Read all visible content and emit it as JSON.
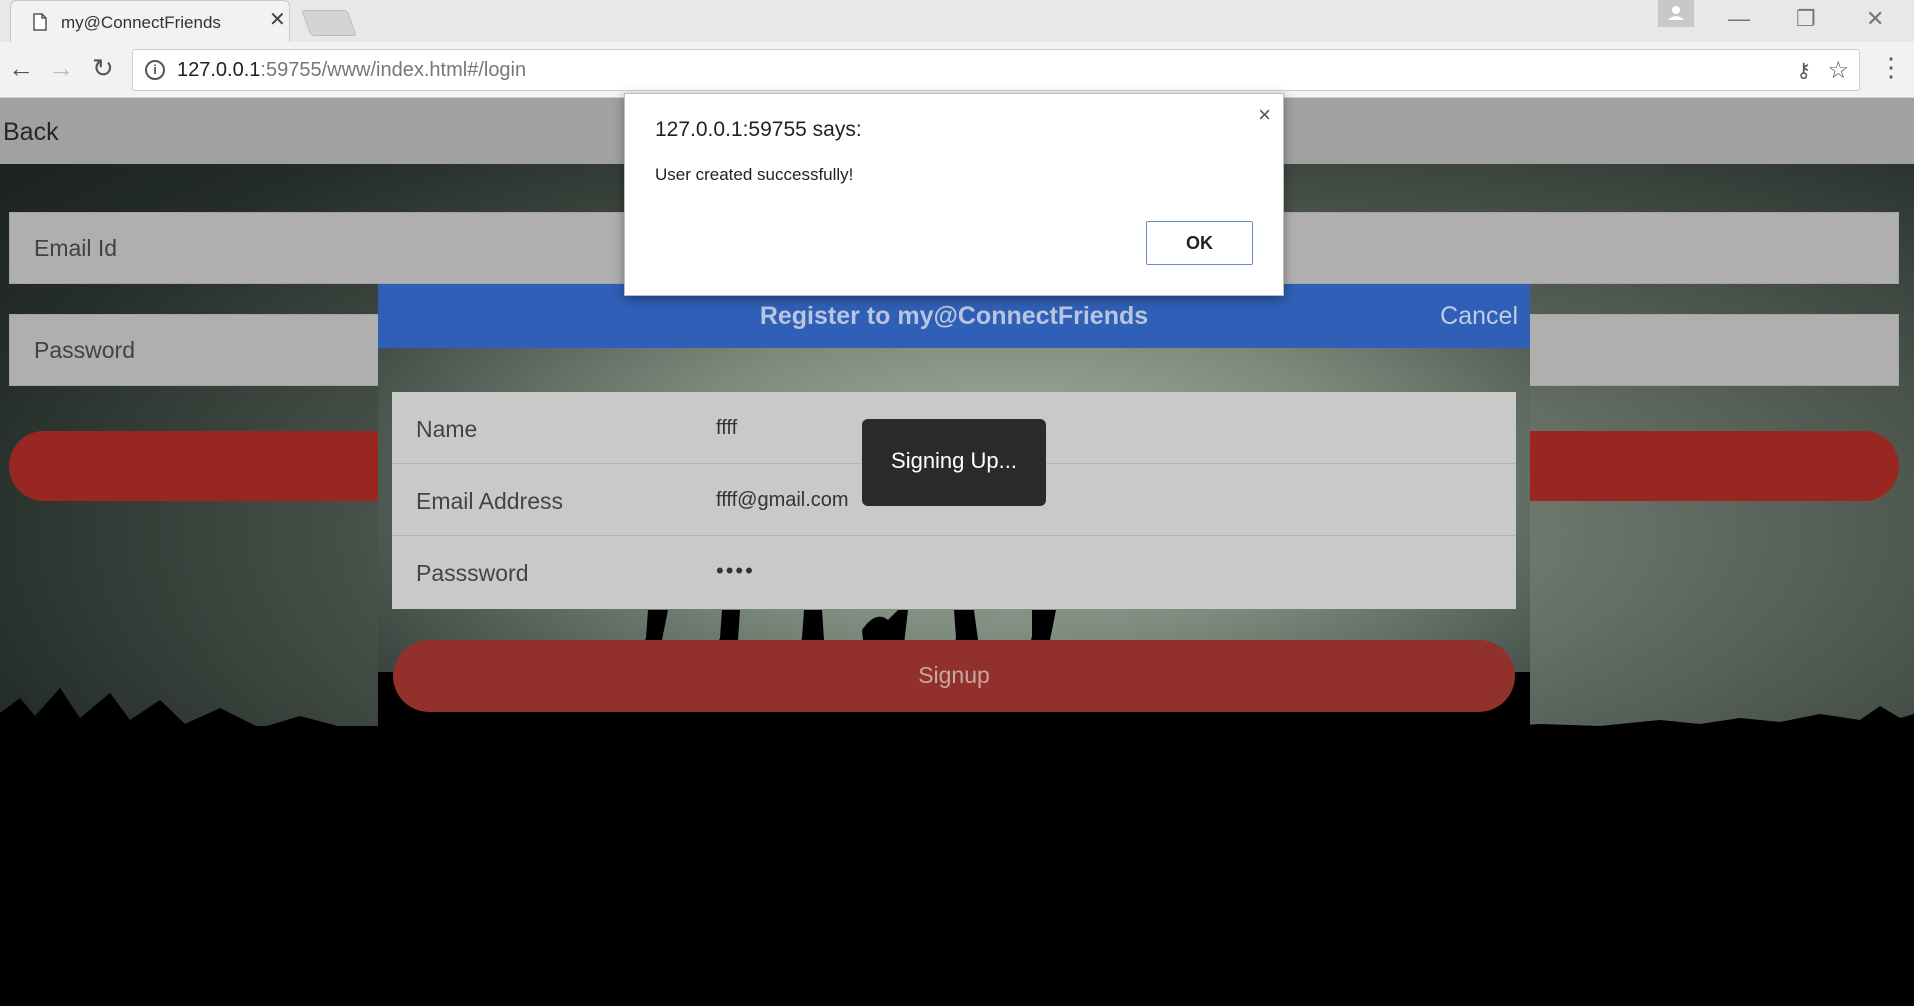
{
  "browser": {
    "tab_title": "my@ConnectFriends",
    "tab_close": "✕",
    "url_host": "127.0.0.1",
    "url_rest": ":59755/www/index.html#/login",
    "icons": [
      "page-icon",
      "back-arrow-icon",
      "forward-arrow-icon",
      "reload-icon",
      "info-icon",
      "key-icon",
      "star-icon",
      "menu-icon",
      "profile-icon",
      "minimize-icon",
      "restore-icon",
      "close-icon"
    ]
  },
  "page": {
    "back_label": "Back",
    "email_placeholder": "Email Id",
    "password_placeholder": "Password"
  },
  "modal": {
    "title": "Register to my@ConnectFriends",
    "cancel_label": "Cancel",
    "fields": [
      {
        "label": "Name",
        "value": "ffff"
      },
      {
        "label": "Email Address",
        "value": "ffff@gmail.com"
      },
      {
        "label": "Passsword",
        "value": "••••"
      }
    ],
    "signup_label": "Signup"
  },
  "loader": {
    "text": "Signing Up..."
  },
  "alert": {
    "origin": "127.0.0.1:59755 says:",
    "message": "User created successfully!",
    "ok_label": "OK",
    "close_glyph": "×"
  },
  "colors": {
    "accent_red": "#c4322b",
    "modal_header_blue": "#2f5fb6"
  }
}
